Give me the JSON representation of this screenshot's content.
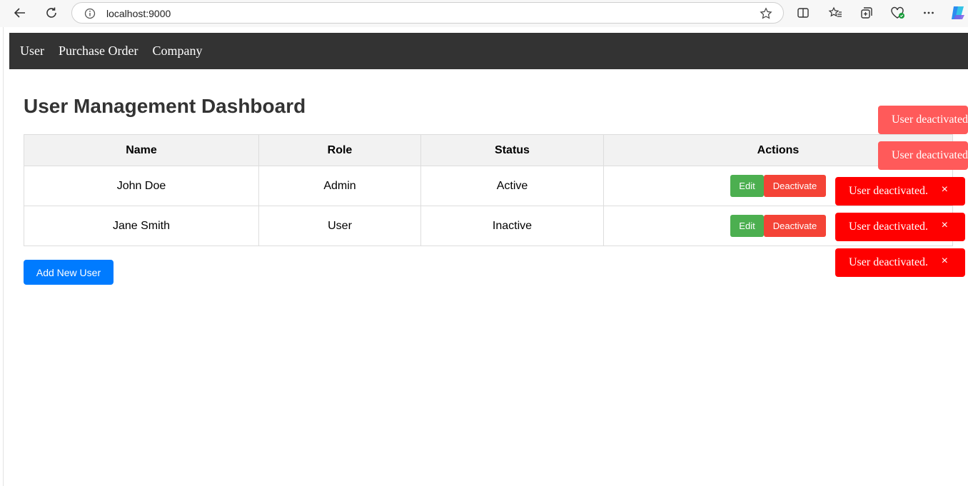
{
  "browser": {
    "url": "localhost:9000"
  },
  "nav": {
    "items": [
      "User",
      "Purchase Order",
      "Company"
    ]
  },
  "page": {
    "title": "User Management Dashboard"
  },
  "table": {
    "headers": [
      "Name",
      "Role",
      "Status",
      "Actions"
    ],
    "rows": [
      {
        "name": "John Doe",
        "role": "Admin",
        "status": "Active"
      },
      {
        "name": "Jane Smith",
        "role": "User",
        "status": "Inactive"
      }
    ],
    "edit_label": "Edit",
    "deactivate_label": "Deactivate"
  },
  "add_user_label": "Add New User",
  "toasts": {
    "faded_text": "User deactivated.",
    "solid_text": "User deactivated.",
    "close_glyph": "×"
  },
  "colors": {
    "nav_bg": "#333333",
    "edit_green": "#4caf50",
    "deactivate_red": "#f44336",
    "add_blue": "#007bff",
    "toast_red": "#ff0000",
    "toast_faded": "#ff5a5a"
  }
}
